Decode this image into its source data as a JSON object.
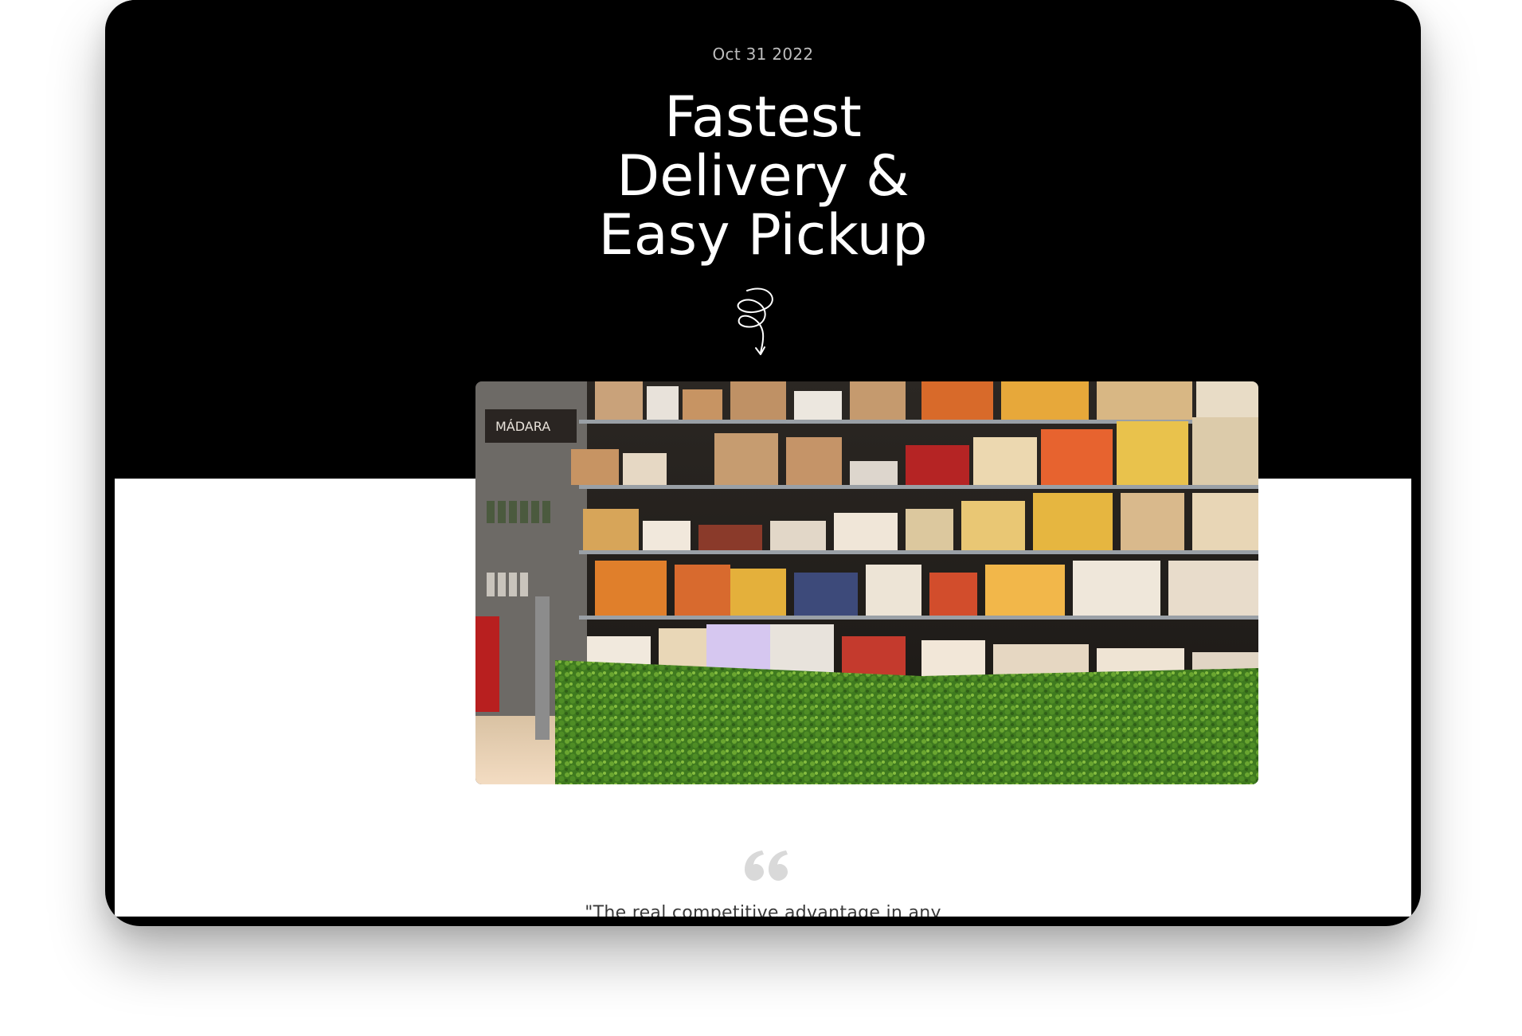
{
  "post": {
    "date": "Oct 31 2022",
    "title_lines": [
      "Fastest",
      "Delivery &",
      "Easy Pickup"
    ],
    "quote_partial": "\"The real competitive advantage in any"
  },
  "image": {
    "semantic": "grocery-store-shelves-photo",
    "brand_sign": "MÁDARA"
  },
  "icons": {
    "swirl": "swirl-arrow-down-icon",
    "quote": "quote-mark-icon"
  },
  "colors": {
    "header_bg": "#000000",
    "body_bg": "#ffffff",
    "title": "#ffffff",
    "date": "#bdbdbd",
    "quote_mark": "#d9d9d9"
  }
}
